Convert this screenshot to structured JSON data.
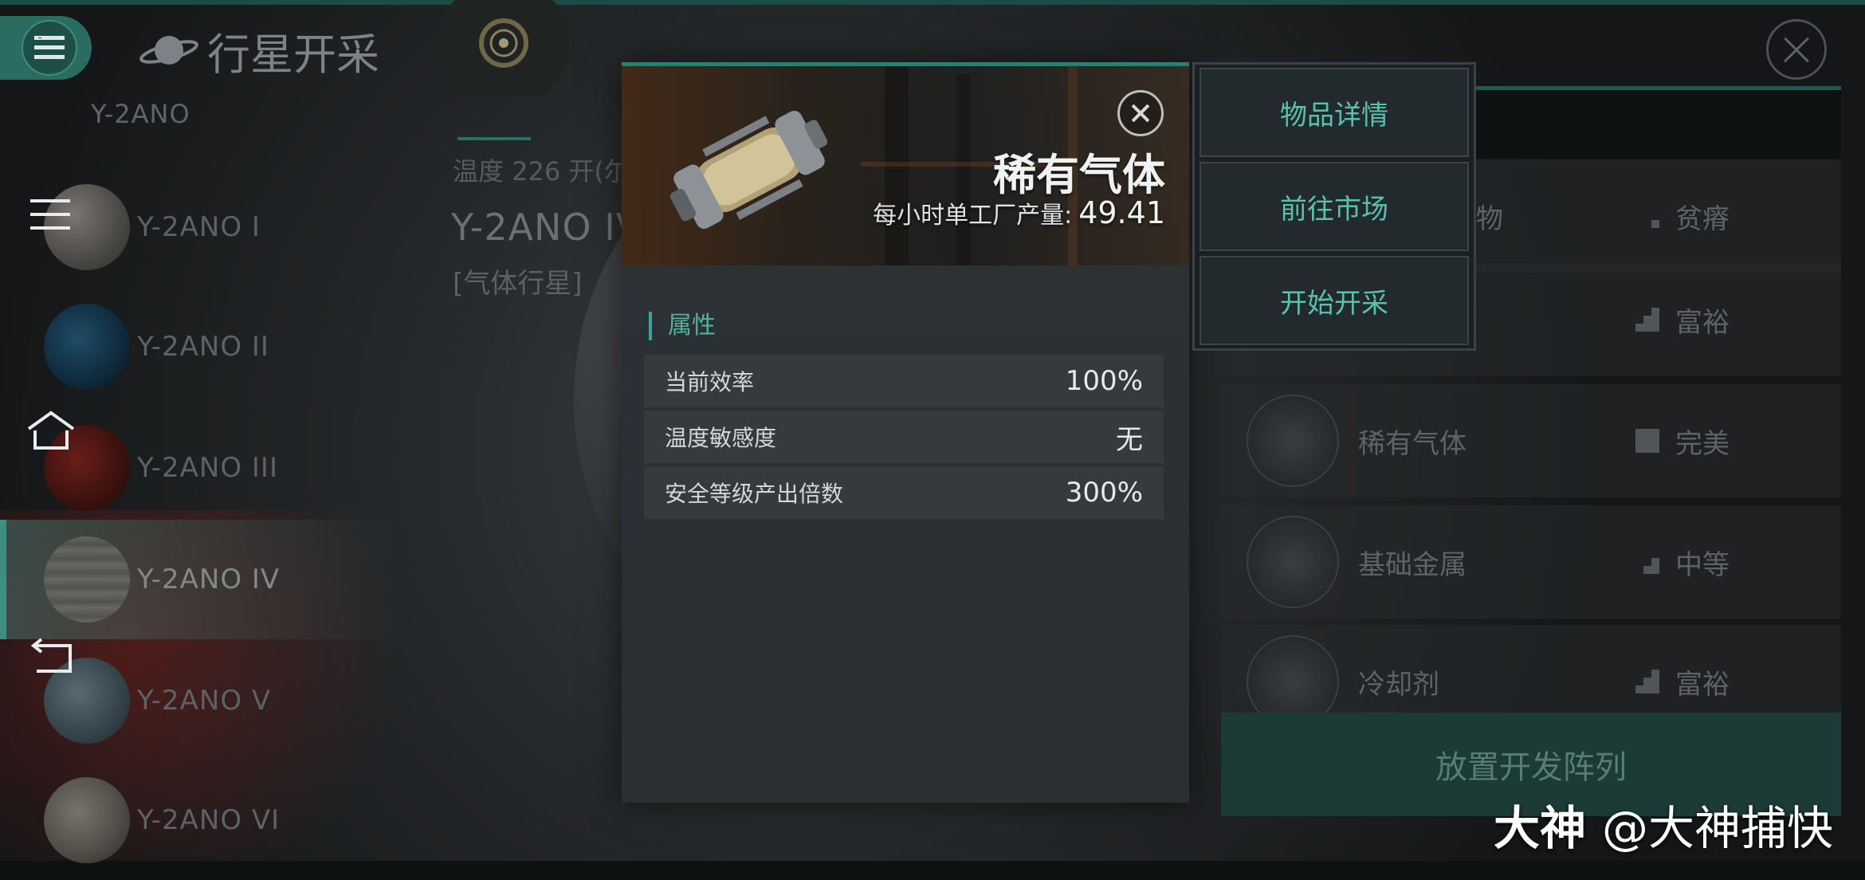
{
  "header": {
    "title": "行星开采",
    "system_name": "Y-2ANO"
  },
  "planets": [
    {
      "label": "Y-2ANO I",
      "selected": false
    },
    {
      "label": "Y-2ANO II",
      "selected": false
    },
    {
      "label": "Y-2ANO III",
      "selected": false
    },
    {
      "label": "Y-2ANO IV",
      "selected": true
    },
    {
      "label": "Y-2ANO V",
      "selected": false
    },
    {
      "label": "Y-2ANO VI",
      "selected": false
    }
  ],
  "planet_info": {
    "temperature": "温度 226 开(尔",
    "name": "Y-2ANO IV",
    "type": "[气体行星]"
  },
  "resources": {
    "rows": [
      {
        "name": "物",
        "grade": "贫瘠"
      },
      {
        "name": "",
        "grade": "富裕"
      },
      {
        "name": "稀有气体",
        "grade": "完美"
      },
      {
        "name": "基础金属",
        "grade": "中等"
      },
      {
        "name": "冷却剂",
        "grade": "富裕"
      }
    ],
    "deploy_label": "放置开发阵列"
  },
  "item": {
    "name": "稀有气体",
    "production_label": "每小时单工厂产量:",
    "production_value": "49.41",
    "attributes_title": "属性",
    "attributes": [
      {
        "key": "当前效率",
        "value": "100%"
      },
      {
        "key": "温度敏感度",
        "value": "无"
      },
      {
        "key": "安全等级产出倍数",
        "value": "300%"
      }
    ]
  },
  "action_menu": {
    "items": [
      "物品详情",
      "前往市场",
      "开始开采"
    ]
  },
  "watermark": {
    "brand": "大神",
    "handle": "@大神捕快"
  },
  "colors": {
    "accent": "#3d8f84",
    "accent_text": "#58c1b0"
  }
}
